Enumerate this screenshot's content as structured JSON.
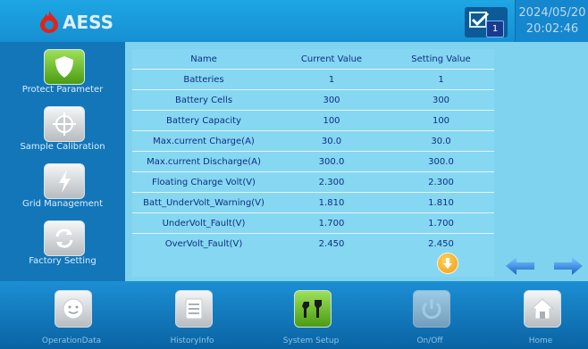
{
  "header": {
    "logo_text": "AESS",
    "notification_count": "1",
    "date": "2024/05/20",
    "time": "20:02:46"
  },
  "sidebar": {
    "items": [
      {
        "label": "Protect Parameter",
        "icon": "shield-icon"
      },
      {
        "label": "Sample Calibration",
        "icon": "crosshair-icon"
      },
      {
        "label": "Grid Management",
        "icon": "lightning-icon"
      },
      {
        "label": "Factory Setting",
        "icon": "refresh-icon"
      }
    ]
  },
  "table": {
    "headers": [
      "Name",
      "Current Value",
      "Setting Value"
    ],
    "rows": [
      {
        "name": "Batteries",
        "current": "1",
        "setting": "1"
      },
      {
        "name": "Battery Cells",
        "current": "300",
        "setting": "300"
      },
      {
        "name": "Battery Capacity",
        "current": "100",
        "setting": "100"
      },
      {
        "name": "Max.current Charge(A)",
        "current": "30.0",
        "setting": "30.0"
      },
      {
        "name": "Max.current Discharge(A)",
        "current": "300.0",
        "setting": "300.0"
      },
      {
        "name": "Floating Charge Volt(V)",
        "current": "2.300",
        "setting": "2.300"
      },
      {
        "name": "Batt_UnderVolt_Warning(V)",
        "current": "1.810",
        "setting": "1.810"
      },
      {
        "name": "UnderVolt_Fault(V)",
        "current": "1.700",
        "setting": "1.700"
      },
      {
        "name": "OverVolt_Fault(V)",
        "current": "2.450",
        "setting": "2.450"
      }
    ]
  },
  "footer": {
    "items": [
      {
        "label": "OperationData",
        "icon": "face-icon"
      },
      {
        "label": "HistoryInfo",
        "icon": "list-icon"
      },
      {
        "label": "System Setup",
        "icon": "tools-icon"
      },
      {
        "label": "On/Off",
        "icon": "power-icon"
      },
      {
        "label": "Home",
        "icon": "home-icon"
      }
    ]
  },
  "colors": {
    "header": "#1590d2",
    "sidebar": "#1276b9",
    "panel": "#86d7f1",
    "text": "#0e2f84",
    "accent_orange": "#f19a16",
    "active_green": "#4a9c13"
  }
}
